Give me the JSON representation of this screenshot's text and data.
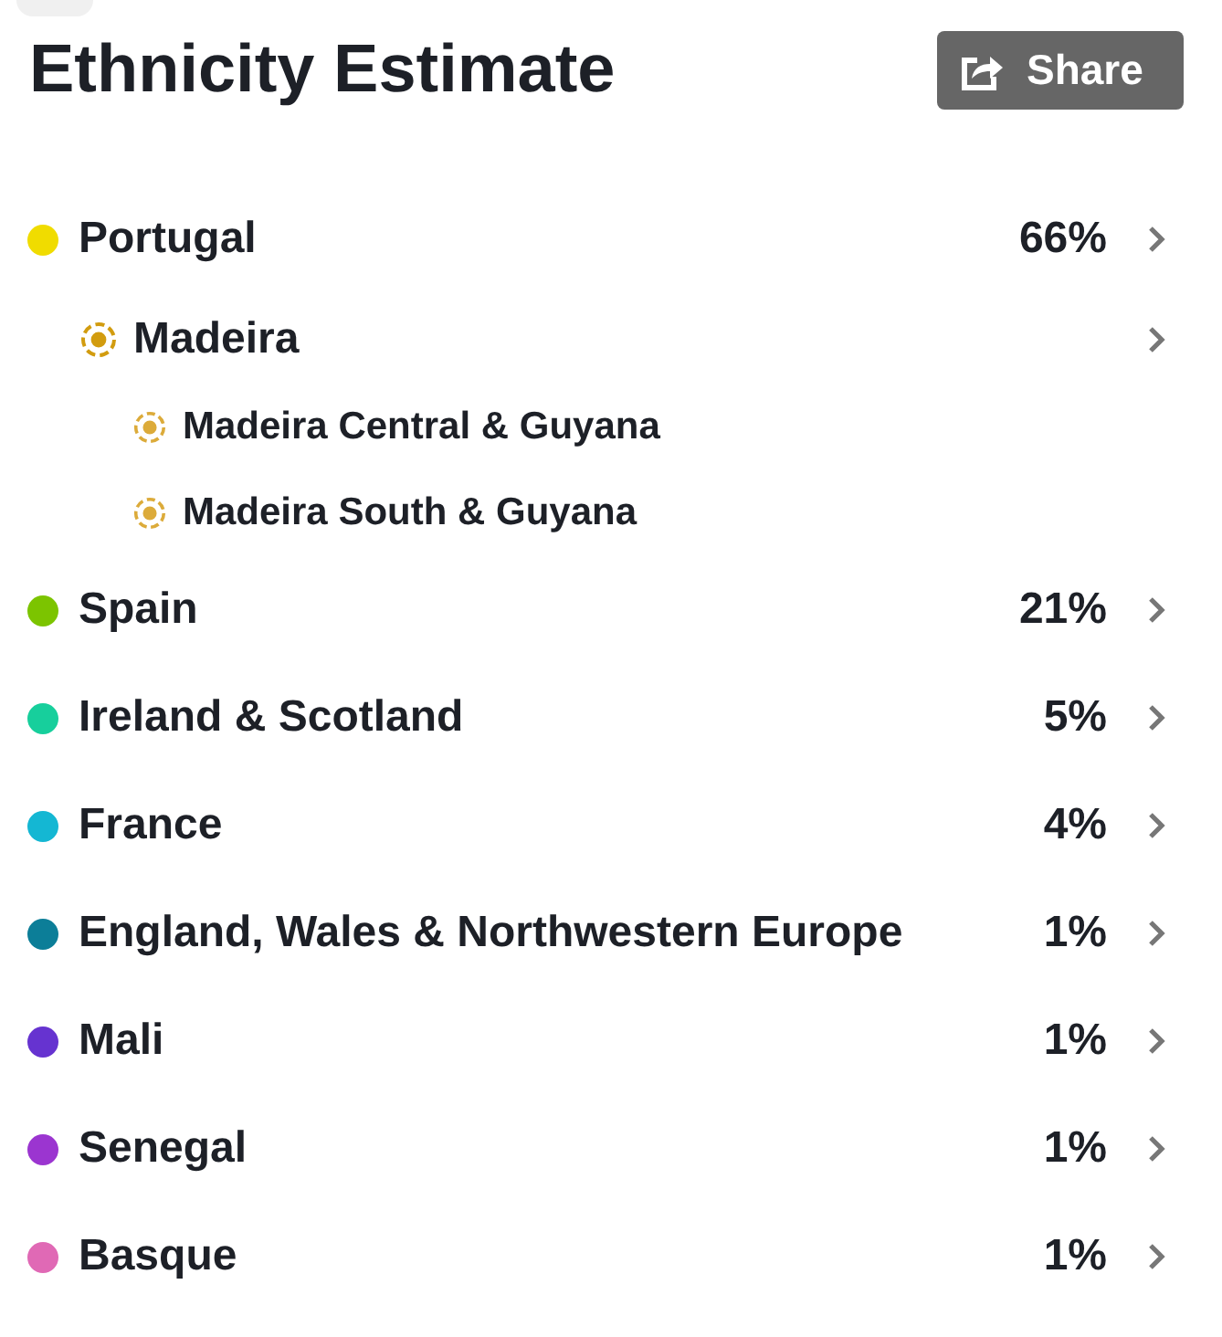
{
  "header": {
    "title": "Ethnicity Estimate",
    "share_button": "Share"
  },
  "regions": [
    {
      "name": "Portugal",
      "percent": "66%",
      "color": "#f0dc00",
      "navigable": true,
      "children": [
        {
          "name": "Madeira",
          "color": "#d29c0f",
          "navigable": true,
          "children": [
            {
              "name": "Madeira Central & Guyana",
              "color": "#dcab3a",
              "navigable": false
            },
            {
              "name": "Madeira South & Guyana",
              "color": "#dcab3a",
              "navigable": false
            }
          ]
        }
      ]
    },
    {
      "name": "Spain",
      "percent": "21%",
      "color": "#7cc400",
      "navigable": true
    },
    {
      "name": "Ireland & Scotland",
      "percent": "5%",
      "color": "#17cf9c",
      "navigable": true
    },
    {
      "name": "France",
      "percent": "4%",
      "color": "#14b7d3",
      "navigable": true
    },
    {
      "name": "England, Wales & Northwestern Europe",
      "percent": "1%",
      "color": "#0c7e98",
      "navigable": true
    },
    {
      "name": "Mali",
      "percent": "1%",
      "color": "#6633d0",
      "navigable": true
    },
    {
      "name": "Senegal",
      "percent": "1%",
      "color": "#9b35d0",
      "navigable": true
    },
    {
      "name": "Basque",
      "percent": "1%",
      "color": "#e069b5",
      "navigable": true
    }
  ]
}
